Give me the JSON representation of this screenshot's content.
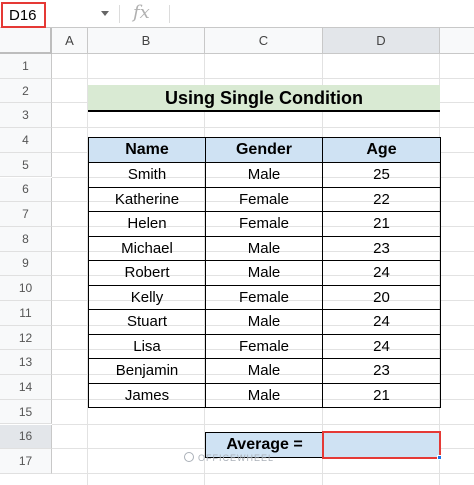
{
  "formula_bar": {
    "name_box": "D16",
    "fx_icon": "fx"
  },
  "columns": [
    "A",
    "B",
    "C",
    "D"
  ],
  "rows": [
    "1",
    "2",
    "3",
    "4",
    "5",
    "6",
    "7",
    "8",
    "9",
    "10",
    "11",
    "12",
    "13",
    "14",
    "15",
    "16",
    "17"
  ],
  "selected_cell": {
    "column": "D",
    "row": "16"
  },
  "title": "Using Single Condition",
  "table": {
    "headers": [
      "Name",
      "Gender",
      "Age"
    ],
    "rows": [
      [
        "Smith",
        "Male",
        "25"
      ],
      [
        "Katherine",
        "Female",
        "22"
      ],
      [
        "Helen",
        "Female",
        "21"
      ],
      [
        "Michael",
        "Male",
        "23"
      ],
      [
        "Robert",
        "Male",
        "24"
      ],
      [
        "Kelly",
        "Female",
        "20"
      ],
      [
        "Stuart",
        "Male",
        "24"
      ],
      [
        "Lisa",
        "Female",
        "24"
      ],
      [
        "Benjamin",
        "Male",
        "23"
      ],
      [
        "James",
        "Male",
        "21"
      ]
    ]
  },
  "average": {
    "label": "Average =",
    "value": ""
  },
  "watermark": "OFFICEWHEEL",
  "colors": {
    "title_bg": "#d9ead3",
    "header_bg": "#cfe2f3",
    "selection_border": "#e53935"
  }
}
